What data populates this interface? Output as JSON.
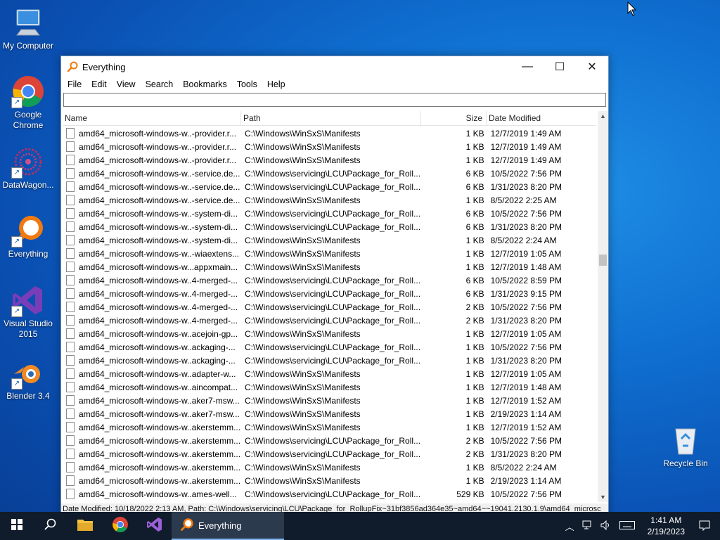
{
  "desktop": {
    "icons": [
      {
        "label": "My Computer"
      },
      {
        "label": "Google Chrome"
      },
      {
        "label": "DataWagon..."
      },
      {
        "label": "Everything"
      },
      {
        "label": "Visual Studio 2015"
      },
      {
        "label": "Blender 3.4"
      },
      {
        "label": "Recycle Bin"
      }
    ]
  },
  "window": {
    "title": "Everything",
    "menu": [
      "File",
      "Edit",
      "View",
      "Search",
      "Bookmarks",
      "Tools",
      "Help"
    ],
    "search_value": "",
    "columns": {
      "name": "Name",
      "path": "Path",
      "size": "Size",
      "date": "Date Modified"
    },
    "rows": [
      {
        "name": "amd64_microsoft-windows-w..-provider.r...",
        "path": "C:\\Windows\\WinSxS\\Manifests",
        "size": "1 KB",
        "date": "12/7/2019 1:49 AM"
      },
      {
        "name": "amd64_microsoft-windows-w..-provider.r...",
        "path": "C:\\Windows\\WinSxS\\Manifests",
        "size": "1 KB",
        "date": "12/7/2019 1:49 AM"
      },
      {
        "name": "amd64_microsoft-windows-w..-provider.r...",
        "path": "C:\\Windows\\WinSxS\\Manifests",
        "size": "1 KB",
        "date": "12/7/2019 1:49 AM"
      },
      {
        "name": "amd64_microsoft-windows-w..-service.de...",
        "path": "C:\\Windows\\servicing\\LCU\\Package_for_Roll...",
        "size": "6 KB",
        "date": "10/5/2022 7:56 PM"
      },
      {
        "name": "amd64_microsoft-windows-w..-service.de...",
        "path": "C:\\Windows\\servicing\\LCU\\Package_for_Roll...",
        "size": "6 KB",
        "date": "1/31/2023 8:20 PM"
      },
      {
        "name": "amd64_microsoft-windows-w..-service.de...",
        "path": "C:\\Windows\\WinSxS\\Manifests",
        "size": "1 KB",
        "date": "8/5/2022 2:25 AM"
      },
      {
        "name": "amd64_microsoft-windows-w..-system-di...",
        "path": "C:\\Windows\\servicing\\LCU\\Package_for_Roll...",
        "size": "6 KB",
        "date": "10/5/2022 7:56 PM"
      },
      {
        "name": "amd64_microsoft-windows-w..-system-di...",
        "path": "C:\\Windows\\servicing\\LCU\\Package_for_Roll...",
        "size": "6 KB",
        "date": "1/31/2023 8:20 PM"
      },
      {
        "name": "amd64_microsoft-windows-w..-system-di...",
        "path": "C:\\Windows\\WinSxS\\Manifests",
        "size": "1 KB",
        "date": "8/5/2022 2:24 AM"
      },
      {
        "name": "amd64_microsoft-windows-w..-wiaextens...",
        "path": "C:\\Windows\\WinSxS\\Manifests",
        "size": "1 KB",
        "date": "12/7/2019 1:05 AM"
      },
      {
        "name": "amd64_microsoft-windows-w...appxmain...",
        "path": "C:\\Windows\\WinSxS\\Manifests",
        "size": "1 KB",
        "date": "12/7/2019 1:48 AM"
      },
      {
        "name": "amd64_microsoft-windows-w..4-merged-...",
        "path": "C:\\Windows\\servicing\\LCU\\Package_for_Roll...",
        "size": "6 KB",
        "date": "10/5/2022 8:59 PM"
      },
      {
        "name": "amd64_microsoft-windows-w..4-merged-...",
        "path": "C:\\Windows\\servicing\\LCU\\Package_for_Roll...",
        "size": "6 KB",
        "date": "1/31/2023 9:15 PM"
      },
      {
        "name": "amd64_microsoft-windows-w..4-merged-...",
        "path": "C:\\Windows\\servicing\\LCU\\Package_for_Roll...",
        "size": "2 KB",
        "date": "10/5/2022 7:56 PM"
      },
      {
        "name": "amd64_microsoft-windows-w..4-merged-...",
        "path": "C:\\Windows\\servicing\\LCU\\Package_for_Roll...",
        "size": "2 KB",
        "date": "1/31/2023 8:20 PM"
      },
      {
        "name": "amd64_microsoft-windows-w..acejoin-gp...",
        "path": "C:\\Windows\\WinSxS\\Manifests",
        "size": "1 KB",
        "date": "12/7/2019 1:05 AM"
      },
      {
        "name": "amd64_microsoft-windows-w..ackaging-...",
        "path": "C:\\Windows\\servicing\\LCU\\Package_for_Roll...",
        "size": "1 KB",
        "date": "10/5/2022 7:56 PM"
      },
      {
        "name": "amd64_microsoft-windows-w..ackaging-...",
        "path": "C:\\Windows\\servicing\\LCU\\Package_for_Roll...",
        "size": "1 KB",
        "date": "1/31/2023 8:20 PM"
      },
      {
        "name": "amd64_microsoft-windows-w..adapter-w...",
        "path": "C:\\Windows\\WinSxS\\Manifests",
        "size": "1 KB",
        "date": "12/7/2019 1:05 AM"
      },
      {
        "name": "amd64_microsoft-windows-w..aincompat...",
        "path": "C:\\Windows\\WinSxS\\Manifests",
        "size": "1 KB",
        "date": "12/7/2019 1:48 AM"
      },
      {
        "name": "amd64_microsoft-windows-w..aker7-msw...",
        "path": "C:\\Windows\\WinSxS\\Manifests",
        "size": "1 KB",
        "date": "12/7/2019 1:52 AM"
      },
      {
        "name": "amd64_microsoft-windows-w..aker7-msw...",
        "path": "C:\\Windows\\WinSxS\\Manifests",
        "size": "1 KB",
        "date": "2/19/2023 1:14 AM"
      },
      {
        "name": "amd64_microsoft-windows-w..akerstemm...",
        "path": "C:\\Windows\\WinSxS\\Manifests",
        "size": "1 KB",
        "date": "12/7/2019 1:52 AM"
      },
      {
        "name": "amd64_microsoft-windows-w..akerstemm...",
        "path": "C:\\Windows\\servicing\\LCU\\Package_for_Roll...",
        "size": "2 KB",
        "date": "10/5/2022 7:56 PM"
      },
      {
        "name": "amd64_microsoft-windows-w..akerstemm...",
        "path": "C:\\Windows\\servicing\\LCU\\Package_for_Roll...",
        "size": "2 KB",
        "date": "1/31/2023 8:20 PM"
      },
      {
        "name": "amd64_microsoft-windows-w..akerstemm...",
        "path": "C:\\Windows\\WinSxS\\Manifests",
        "size": "1 KB",
        "date": "8/5/2022 2:24 AM"
      },
      {
        "name": "amd64_microsoft-windows-w..akerstemm...",
        "path": "C:\\Windows\\WinSxS\\Manifests",
        "size": "1 KB",
        "date": "2/19/2023 1:14 AM"
      },
      {
        "name": "amd64_microsoft-windows-w..ames-well...",
        "path": "C:\\Windows\\servicing\\LCU\\Package_for_Roll...",
        "size": "529 KB",
        "date": "10/5/2022 7:56 PM"
      }
    ],
    "status": "Date Modified: 10/18/2022 2:13 AM, Path: C:\\Windows\\servicing\\LCU\\Package_for_RollupFix~31bf3856ad364e35~amd64~~19041.2130.1.9\\amd64_microsc"
  },
  "taskbar": {
    "active_app": "Everything",
    "time": "1:41 AM",
    "date": "2/19/2023"
  },
  "colors": {
    "accent": "#0a64c8",
    "taskbar": "#101c2c"
  }
}
